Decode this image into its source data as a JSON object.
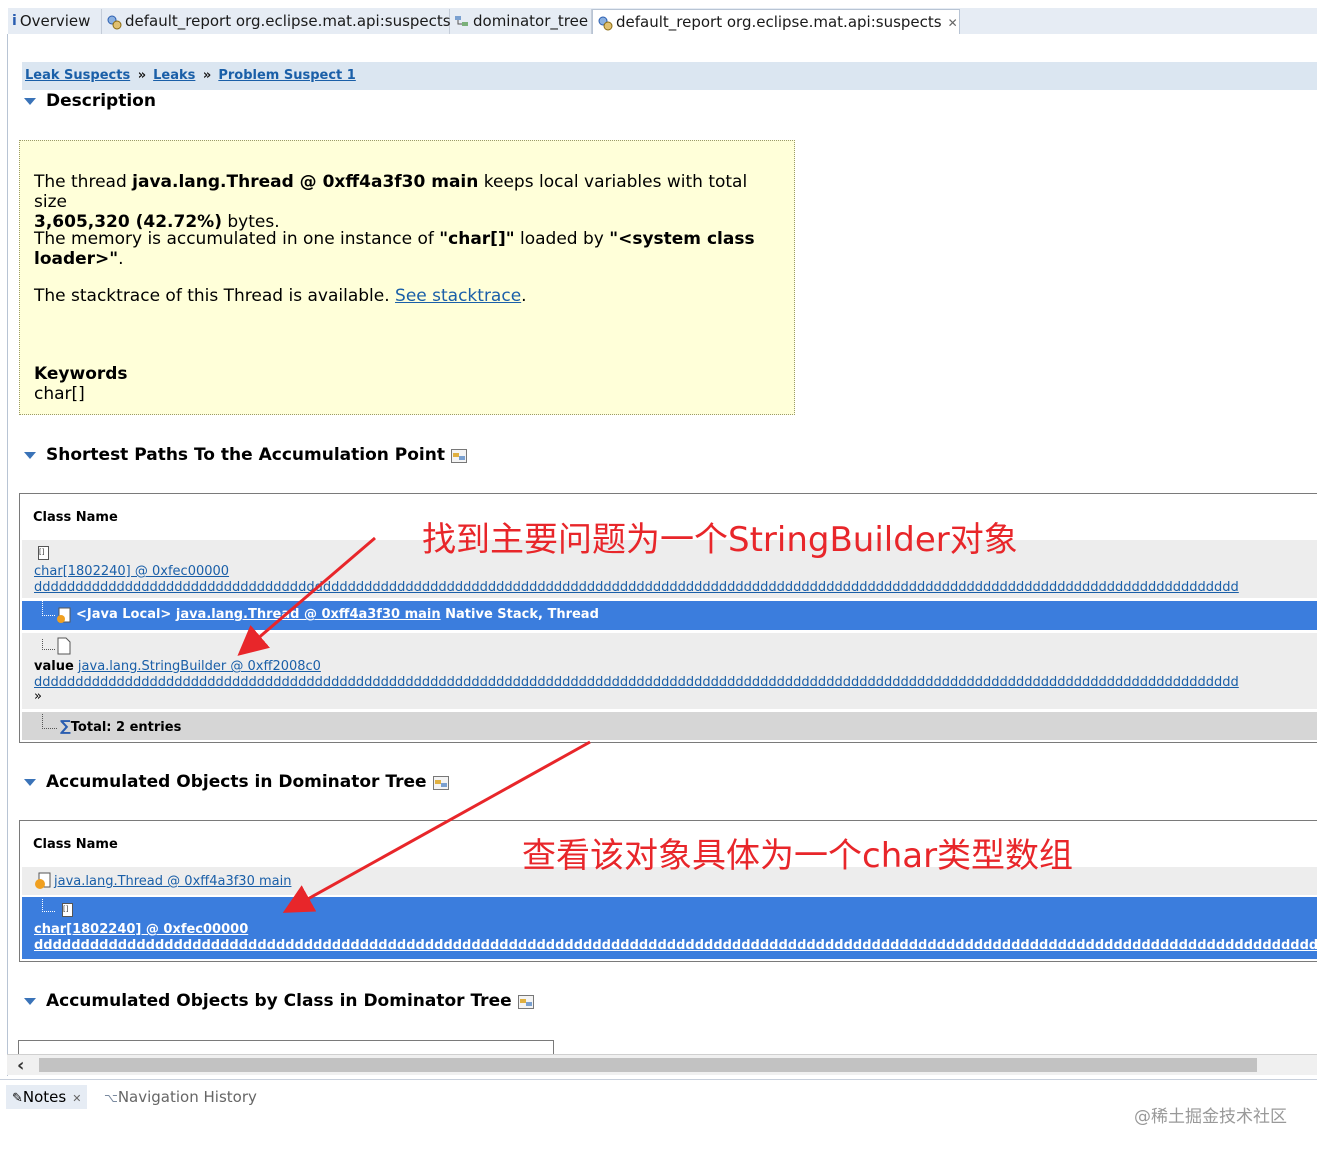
{
  "tabs": [
    {
      "label": "Overview",
      "icon": "info-icon"
    },
    {
      "label": "default_report  org.eclipse.mat.api:suspects",
      "icon": "report-icon"
    },
    {
      "label": "dominator_tree",
      "icon": "tree-icon"
    },
    {
      "label": "default_report  org.eclipse.mat.api:suspects",
      "icon": "report-icon",
      "active": true
    }
  ],
  "breadcrumbs": [
    "Leak Suspects",
    "Leaks",
    "Problem Suspect 1"
  ],
  "breadcrumb_separator": "»",
  "description": {
    "title": "Description",
    "p1_a": "The thread ",
    "p1_b": "java.lang.Thread @ 0xff4a3f30 main",
    "p1_c": " keeps local variables with total size",
    "p1_d": "3,605,320 (42.72%)",
    "p1_e": " bytes.",
    "p2_a": "The memory is accumulated in one instance of ",
    "p2_b": "\"char[]\"",
    "p2_c": " loaded by ",
    "p2_d": "\"<system class",
    "p2_e": "loader>\"",
    "p2_f": ".",
    "p3_a": "The stacktrace of this Thread is available. ",
    "p3_link": "See stacktrace",
    "p3_b": ".",
    "keywords_label": "Keywords",
    "keywords_value": "char[]"
  },
  "shortest_paths": {
    "title": "Shortest Paths To the Accumulation Point",
    "column": "Class Name",
    "row1_link": "char[1802240] @ 0xfec00000",
    "row1_dd": "dddddddddddddddddddddddddddddddddddddddddddddddddddddddddddddddddddddddddddddddddddddddddddddddddddddddddddddddddddddddddddddddddddddddddddddddddd",
    "row2_prefix": "<Java Local>",
    "row2_link": "java.lang.Thread @ 0xff4a3f30 main",
    "row2_suffix": "Native Stack, Thread",
    "row3_label": "value",
    "row3_link": "java.lang.StringBuilder @ 0xff2008c0",
    "row3_dd": "dddddddddddddddddddddddddddddddddddddddddddddddddddddddddddddddddddddddddddddddddddddddddddddddddddddddddddddddddddddddddddddddddddddddddddddddddd",
    "row3_more": "»",
    "total": "Total: 2 entries"
  },
  "dominator": {
    "title": "Accumulated Objects in Dominator Tree",
    "column": "Class Name",
    "row1_link": "java.lang.Thread @ 0xff4a3f30 main",
    "row2_link": "char[1802240] @ 0xfec00000",
    "row2_dd": "dddddddddddddddddddddddddddddddddddddddddddddddddddddddddddddddddddddddddddddddddddddddddddddddddddddddddddddddddddddddddddddddddddddddddddddddddd"
  },
  "by_class": {
    "title": "Accumulated Objects by Class in Dominator Tree"
  },
  "annotations": {
    "top": "找到主要问题为一个StringBuilder对象",
    "bottom": "查看该对象具体为一个char类型数组"
  },
  "bottom_tabs": [
    {
      "label": "Notes",
      "icon": "notes-icon",
      "active": true
    },
    {
      "label": "Navigation History",
      "icon": "history-icon"
    }
  ],
  "watermark": "@稀土掘金技术社区",
  "colors": {
    "selection": "#3b7ddd",
    "annotation": "#e8262a",
    "description_bg": "#ffffd9",
    "link": "#1a5fa8"
  }
}
